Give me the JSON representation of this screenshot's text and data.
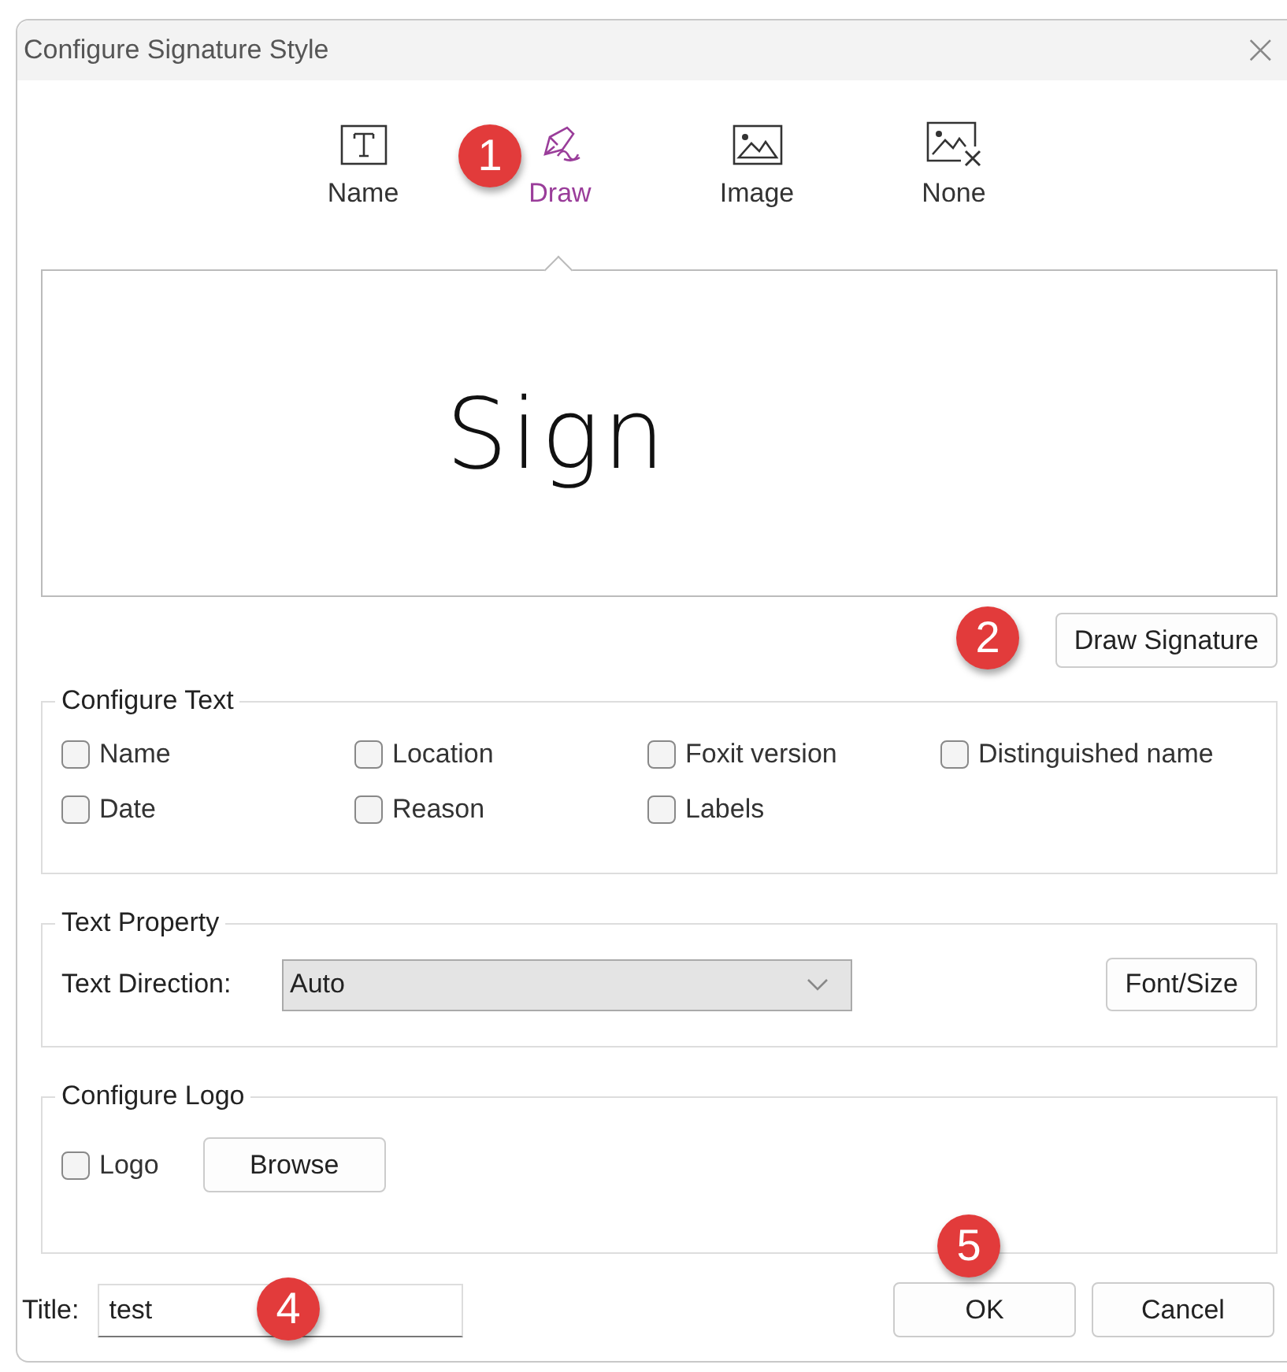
{
  "window": {
    "title": "Configure Signature Style",
    "close": "×"
  },
  "tabs": [
    {
      "label": "Name",
      "kind": "text",
      "selected": false
    },
    {
      "label": "Draw",
      "kind": "draw",
      "selected": true
    },
    {
      "label": "Image",
      "kind": "image",
      "selected": false
    },
    {
      "label": "None",
      "kind": "none",
      "selected": false
    }
  ],
  "signature_preview": {
    "text": "Sign"
  },
  "draw_button": "Draw Signature",
  "configure_text": {
    "legend": "Configure Text",
    "options": [
      {
        "label": "Name",
        "checked": false
      },
      {
        "label": "Location",
        "checked": false
      },
      {
        "label": "Foxit version",
        "checked": false
      },
      {
        "label": "Distinguished name",
        "checked": false
      },
      {
        "label": "Date",
        "checked": false
      },
      {
        "label": "Reason",
        "checked": false
      },
      {
        "label": "Labels",
        "checked": false
      }
    ]
  },
  "text_property": {
    "legend": "Text Property",
    "direction_label": "Text Direction:",
    "direction_value": "Auto",
    "font_button": "Font/Size"
  },
  "configure_logo": {
    "legend": "Configure Logo",
    "logo": {
      "label": "Logo",
      "checked": false
    },
    "browse_button": "Browse"
  },
  "title_field": {
    "label": "Title:",
    "value": "test"
  },
  "buttons": [
    "OK",
    "Cancel"
  ],
  "callouts": [
    "1",
    "2",
    "4",
    "5"
  ]
}
